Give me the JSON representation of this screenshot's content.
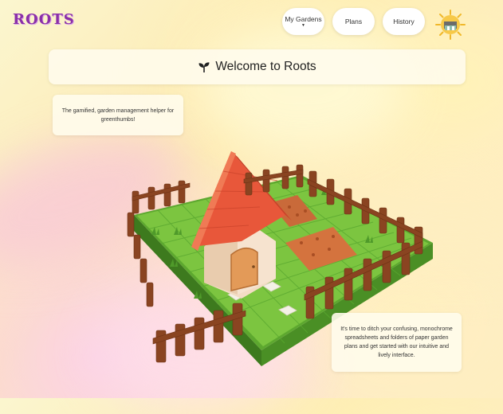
{
  "app": {
    "logo": "ROOTS"
  },
  "nav": {
    "my_gardens": "My Gardens",
    "plans": "Plans",
    "history": "History",
    "avatar_icon": "sun-house-avatar-icon"
  },
  "welcome": {
    "icon": "sprout-icon",
    "title": "Welcome to Roots"
  },
  "tagline": "The gamified, garden management helper for greenthumbs!",
  "pitch": "It's time to ditch your confusing, monochrome spreadsheets and folders of paper garden plans and get started with our intuitive and lively interface.",
  "illustration": "garden-house-illustration",
  "colors": {
    "accent": "#8a2fa8",
    "grass": "#7cc540",
    "roof": "#e8573a",
    "fence": "#8a4421"
  }
}
